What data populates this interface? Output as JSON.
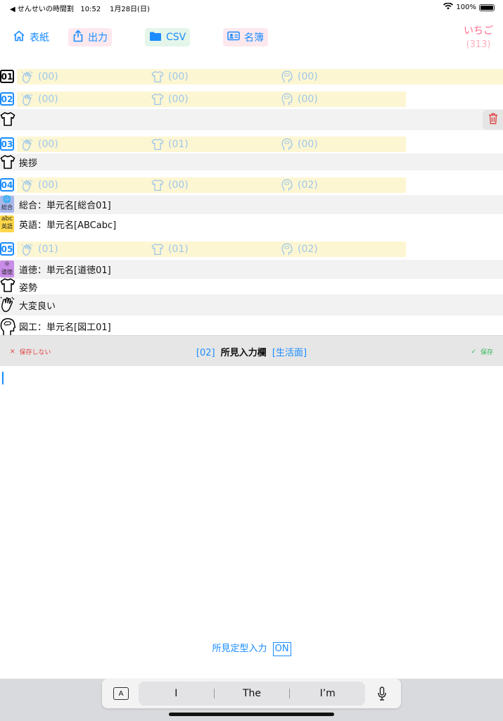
{
  "status": {
    "back_app": "◀ せんせいの時間割",
    "time": "10:52",
    "date": "1月28日(日)",
    "battery": "100%"
  },
  "toolbar": {
    "cover": "表紙",
    "export": "出力",
    "csv": "CSV",
    "roster": "名簿"
  },
  "user": {
    "name": "いちご",
    "count": "(313)"
  },
  "periods": [
    {
      "no": "01",
      "a": "(00)",
      "b": "(00)",
      "c": "(00)"
    },
    {
      "no": "02",
      "a": "(00)",
      "b": "(00)",
      "c": "(00)"
    },
    {
      "no": "03",
      "a": "(00)",
      "b": "(01)",
      "c": "(00)"
    },
    {
      "no": "04",
      "a": "(00)",
      "b": "(00)",
      "c": "(02)"
    },
    {
      "no": "05",
      "a": "(01)",
      "b": "(01)",
      "c": "(02)"
    }
  ],
  "entries": {
    "greeting": "挨拶",
    "sogo": "総合：単元名[総合01]",
    "eigo": "英語：単元名[ABCabc]",
    "dotoku": "道徳：単元名[道徳01]",
    "shisei": "姿勢",
    "taihen": "大変良い",
    "zuko": "図工：単元名[図工01]"
  },
  "subject_badges": {
    "sogo": "総合",
    "eigo_top": "abc",
    "eigo_bottom": "英語",
    "dotoku": "道徳"
  },
  "editbar": {
    "nosave": "保存しない",
    "period": "[02]",
    "title": "所見入力欄",
    "category": "[生活面]",
    "save": "保存"
  },
  "template_toggle": {
    "label": "所見定型入力",
    "state": "ON"
  },
  "keyboard": {
    "a_key": "A",
    "suggestions": [
      "I",
      "The",
      "I’m"
    ]
  }
}
